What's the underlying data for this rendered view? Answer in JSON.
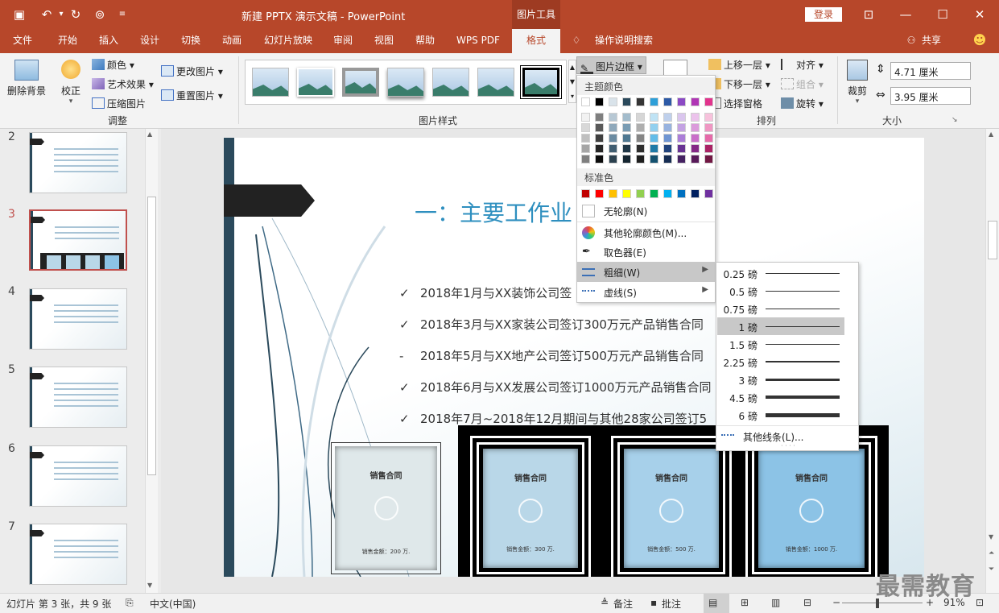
{
  "window": {
    "title": "新建 PPTX 演示文稿 - PowerPoint",
    "context_tools": "图片工具",
    "login": "登录",
    "share": "共享"
  },
  "tabs": [
    "文件",
    "开始",
    "插入",
    "设计",
    "切换",
    "动画",
    "幻灯片放映",
    "审阅",
    "视图",
    "帮助",
    "WPS PDF",
    "格式"
  ],
  "active_tab": "格式",
  "search_tab": "操作说明搜索",
  "ribbon": {
    "adjust": {
      "remove_bg": "删除背景",
      "correct": "校正",
      "color": "颜色",
      "art_effect": "艺术效果",
      "compress": "压缩图片",
      "change_pic": "更改图片",
      "reset_pic": "重置图片",
      "group_label": "调整"
    },
    "styles": {
      "group_label": "图片样式",
      "border_button": "图片边框"
    },
    "arrange": {
      "bring_forward": "上移一层",
      "send_backward": "下移一层",
      "selection_pane": "选择窗格",
      "align": "对齐",
      "group": "组合",
      "rotate": "旋转",
      "group_label": "排列"
    },
    "size": {
      "crop": "裁剪",
      "height": "4.71 厘米",
      "width": "3.95 厘米",
      "group_label": "大小"
    }
  },
  "slides": [
    {
      "num": "2",
      "heading": "前言"
    },
    {
      "num": "3",
      "heading": "一、主要工作业绩"
    },
    {
      "num": "4",
      "heading": "二、出现问题"
    },
    {
      "num": "5",
      "heading": "三、积极开拓市场策略"
    },
    {
      "num": "6",
      "heading": "四、团队建设"
    },
    {
      "num": "7",
      "heading": "五、明年计划"
    }
  ],
  "slide": {
    "title": "一：主要工作业",
    "bullets": [
      {
        "mark": "✓",
        "text": "2018年1月与XX装饰公司签"
      },
      {
        "mark": "✓",
        "text": "2018年3月与XX家装公司签订300万元产品销售合同"
      },
      {
        "mark": "-",
        "text": "2018年5月与XX地产公司签订500万元产品销售合同"
      },
      {
        "mark": "✓",
        "text": "2018年6月与XX发展公司签订1000万元产品销售合同"
      },
      {
        "mark": "✓",
        "text": "2018年7月~2018年12月期间与其他28家公司签订5"
      }
    ],
    "contracts": [
      {
        "title": "销售合同",
        "amount": "销售金额：200 万."
      },
      {
        "title": "销售合同",
        "amount": "销售金额：300 万."
      },
      {
        "title": "销售合同",
        "amount": "销售金额：500 万."
      },
      {
        "title": "销售合同",
        "amount": "销售金额：1000 万."
      }
    ]
  },
  "border_menu": {
    "theme_colors": "主题颜色",
    "standard_colors": "标准色",
    "no_outline": "无轮廓(N)",
    "more_colors": "其他轮廓颜色(M)...",
    "eyedropper": "取色器(E)",
    "weight": "粗细(W)",
    "dashes": "虚线(S)",
    "theme_top_row": [
      "#ffffff",
      "#000000",
      "#d9e3ea",
      "#2b4a5c",
      "#353535",
      "#2e9fd8",
      "#2d5aa6",
      "#8b4ac4",
      "#b036b5",
      "#e2348d"
    ],
    "theme_shades": [
      [
        "#f2f2f2",
        "#7f7f7f",
        "#b7c8d4",
        "#a3bccc",
        "#d6d6d6",
        "#bfe3f5",
        "#bfd0ec",
        "#dac6ee",
        "#ecc3ec",
        "#f7c2dc"
      ],
      [
        "#d8d8d8",
        "#595959",
        "#8fa9bb",
        "#7a9cb3",
        "#aeaeae",
        "#93d0ef",
        "#98b3df",
        "#c4a3e3",
        "#db9bdb",
        "#ef97c3"
      ],
      [
        "#bfbfbf",
        "#3f3f3f",
        "#6b8ba1",
        "#4f7891",
        "#858585",
        "#63bce8",
        "#6f95d2",
        "#ab7ed8",
        "#c96fc9",
        "#e66aa9"
      ],
      [
        "#a5a5a5",
        "#262626",
        "#405d70",
        "#203747",
        "#2e2e2e",
        "#1f7aa7",
        "#21437c",
        "#683393",
        "#842886",
        "#aa2265"
      ],
      [
        "#7f7f7f",
        "#0c0c0c",
        "#2c414f",
        "#152530",
        "#1f1f1f",
        "#14516f",
        "#162d53",
        "#452262",
        "#581a59",
        "#711743"
      ]
    ],
    "standard_row": [
      "#c00000",
      "#ff0000",
      "#ffc000",
      "#ffff00",
      "#92d050",
      "#00b050",
      "#00b0f0",
      "#0070c0",
      "#002060",
      "#7030a0"
    ]
  },
  "weight_menu": {
    "items": [
      {
        "label": "0.25 磅",
        "weight": 0.25
      },
      {
        "label": "0.5 磅",
        "weight": 0.5
      },
      {
        "label": "0.75 磅",
        "weight": 0.75
      },
      {
        "label": "1 磅",
        "weight": 1
      },
      {
        "label": "1.5 磅",
        "weight": 1.5
      },
      {
        "label": "2.25 磅",
        "weight": 2.25
      },
      {
        "label": "3 磅",
        "weight": 3
      },
      {
        "label": "4.5 磅",
        "weight": 4.5
      },
      {
        "label": "6 磅",
        "weight": 6
      }
    ],
    "selected": "1 磅",
    "more_lines": "其他线条(L)..."
  },
  "status": {
    "slide_info": "幻灯片 第 3 张，共 9 张",
    "language": "中文(中国)",
    "notes": "备注",
    "comments": "批注",
    "zoom": "91%"
  },
  "watermark": "最需教育",
  "accent": "#b7472a"
}
